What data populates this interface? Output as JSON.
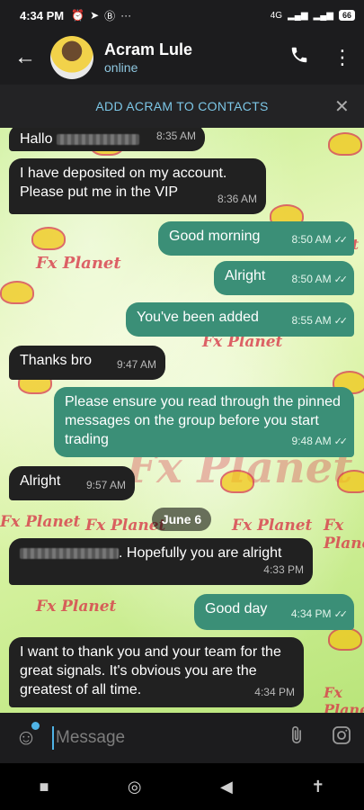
{
  "status_bar": {
    "time": "4:34 PM",
    "status_icons": [
      "alarm-icon",
      "telegram-icon",
      "b-icon"
    ],
    "more": "···",
    "network": "4G",
    "battery": "66"
  },
  "header": {
    "name": "Acram Lule",
    "presence": "online",
    "back_icon": "arrow-left-icon",
    "call_icon": "phone-icon",
    "menu_icon": "kebab-menu-icon"
  },
  "add_contact_bar": {
    "label": "ADD ACRAM TO CONTACTS",
    "close_icon": "close-icon"
  },
  "watermark": {
    "text": "Fx Planet"
  },
  "messages": [
    {
      "dir": "in",
      "text": "Hallo",
      "time": "8:35 AM"
    },
    {
      "dir": "in",
      "text": "I have deposited on my account. Please put me in the VIP",
      "time": "8:36 AM"
    },
    {
      "dir": "out",
      "text": "Good morning",
      "time": "8:50 AM",
      "ticks": "✓✓"
    },
    {
      "dir": "out",
      "text": "Alright",
      "time": "8:50 AM",
      "ticks": "✓✓"
    },
    {
      "dir": "out",
      "text": "You've been added",
      "time": "8:55 AM",
      "ticks": "✓✓"
    },
    {
      "dir": "in",
      "text": "Thanks bro",
      "time": "9:47 AM"
    },
    {
      "dir": "out",
      "text": "Please ensure you read through the pinned messages on the group before you start trading",
      "time": "9:48 AM",
      "ticks": "✓✓"
    },
    {
      "dir": "in",
      "text": "Alright",
      "time": "9:57 AM"
    },
    {
      "dir": "in",
      "text": ". Hopefully you are alright",
      "time": "4:33 PM"
    },
    {
      "dir": "out",
      "text": "Good day",
      "time": "4:34 PM",
      "ticks": "✓✓"
    },
    {
      "dir": "in",
      "text": "I want to thank you and your team for the great signals. It's obvious you are the greatest of all time.",
      "time": "4:34 PM"
    }
  ],
  "date_separator": "June 6",
  "input": {
    "placeholder": "Message",
    "emoji_icon": "sticker-icon",
    "attach_icon": "paperclip-icon",
    "camera_icon": "instagram-camera-icon"
  },
  "navbar": {
    "icons": [
      "square-recents-icon",
      "circle-home-icon",
      "triangle-back-icon",
      "accessibility-icon"
    ]
  },
  "colors": {
    "header_bg": "#1c1c1e",
    "incoming_bubble": "#212121",
    "outgoing_bubble": "#3b8f77",
    "accent": "#4fb3e6",
    "link": "#7cc6e6"
  }
}
